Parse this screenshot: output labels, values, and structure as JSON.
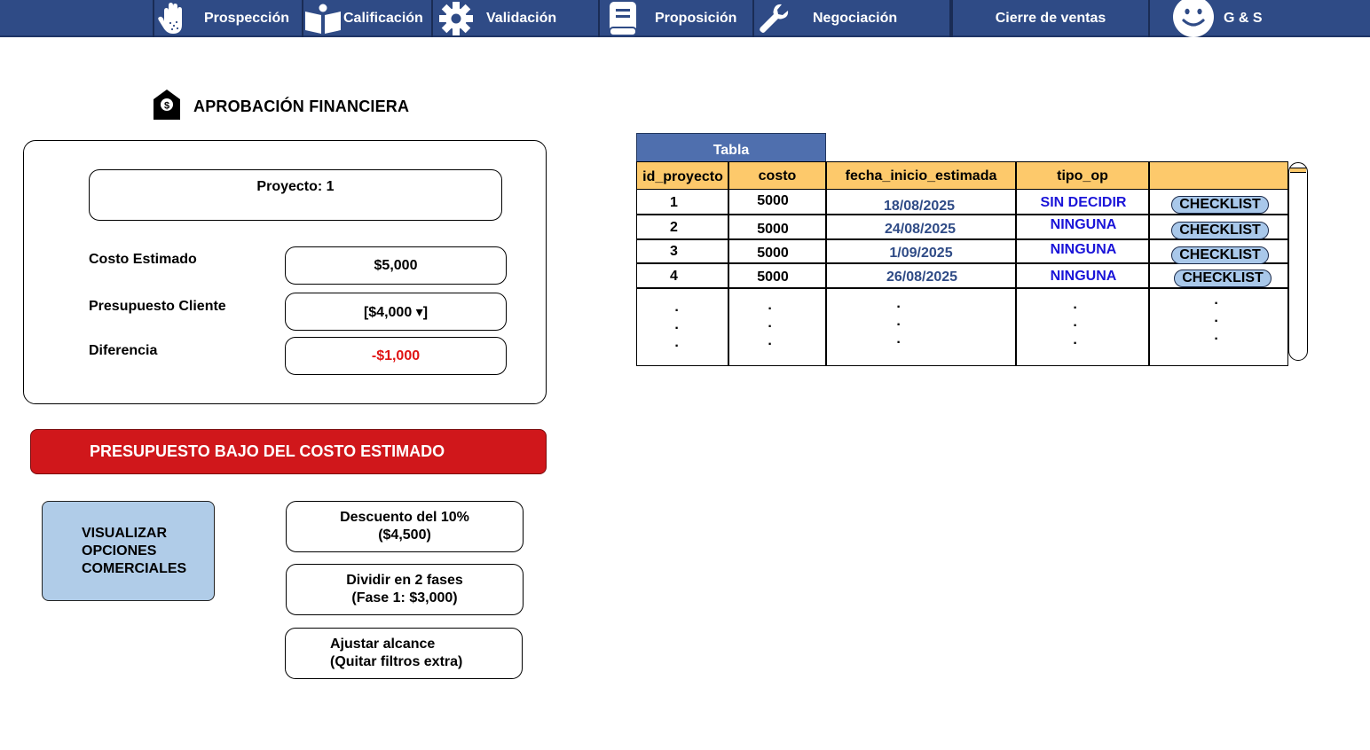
{
  "nav": {
    "items": [
      {
        "label": "Prospección",
        "icon": "hand-icon"
      },
      {
        "label": "Calificación",
        "icon": "open-book-icon"
      },
      {
        "label": "Validación",
        "icon": "gear-icon"
      },
      {
        "label": "Proposición",
        "icon": "document-icon"
      },
      {
        "label": "Negociación",
        "icon": "wrench-icon"
      },
      {
        "label": "Cierre de ventas",
        "icon": ""
      },
      {
        "label": "G & S",
        "icon": "smiley-icon"
      }
    ]
  },
  "page": {
    "title": "APROBACIÓN FINANCIERA",
    "title_icon": "money-envelope-icon"
  },
  "finance": {
    "project": "Proyecto: 1",
    "cost_label": "Costo Estimado",
    "cost_value": "$5,000",
    "budget_label": "Presupuesto Cliente",
    "budget_value": "[$4,000 ▾]",
    "diff_label": "Diferencia",
    "diff_value": "-$1,000"
  },
  "alert": {
    "text": "PRESUPUESTO BAJO DEL COSTO ESTIMADO"
  },
  "options": {
    "visualize": [
      "VISUALIZAR",
      "OPCIONES",
      "COMERCIALES"
    ],
    "discount": [
      "Descuento del 10%",
      "($4,500)"
    ],
    "split": [
      "Dividir en 2 fases",
      "(Fase 1: $3,000)"
    ],
    "scope": [
      "Ajustar alcance",
      "(Quitar filtros extra)"
    ]
  },
  "table": {
    "title": "Tabla",
    "headers": [
      "id_proyecto",
      "costo",
      "fecha_inicio_estimada",
      "tipo_op",
      ""
    ],
    "rows": [
      {
        "id": "1",
        "costo": "5000",
        "fecha": "18/08/2025",
        "tipo": "SIN DECIDIR",
        "action": "CHECKLIST"
      },
      {
        "id": "2",
        "costo": "5000",
        "fecha": "24/08/2025",
        "tipo": "NINGUNA",
        "action": "CHECKLIST"
      },
      {
        "id": "3",
        "costo": "5000",
        "fecha": "1/09/2025",
        "tipo": "NINGUNA",
        "action": "CHECKLIST"
      },
      {
        "id": "4",
        "costo": "5000",
        "fecha": "26/08/2025",
        "tipo": "NINGUNA",
        "action": "CHECKLIST"
      }
    ],
    "ellipsis": "·"
  },
  "colors": {
    "nav_bg": "#2f4b86",
    "alert_bg": "#d0171b",
    "header_bg": "#fdc96b",
    "button_blue": "#a9c8ea",
    "negative": "#e01414",
    "date_text": "#2f4b86",
    "tipo_text": "#1a14d8"
  }
}
